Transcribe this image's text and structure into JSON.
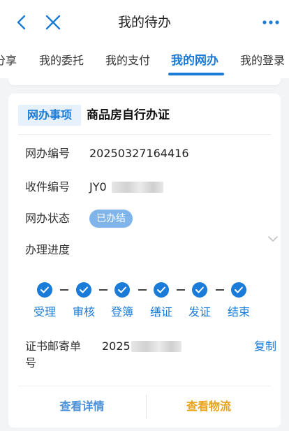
{
  "header": {
    "title": "我的待办",
    "back_icon": "chevron-left-icon",
    "close_icon": "close-icon",
    "more_icon": "more-horizontal-icon"
  },
  "tabs": [
    {
      "label": "分享",
      "active": false
    },
    {
      "label": "我的委托",
      "active": false
    },
    {
      "label": "我的支付",
      "active": false
    },
    {
      "label": "我的网办",
      "active": true
    },
    {
      "label": "我的登录",
      "active": false
    }
  ],
  "card": {
    "type_tag": "网办事项",
    "case_name": "商品房自行办证",
    "fields": {
      "number_label": "网办编号",
      "number_value": "20250327164416",
      "receipt_label": "收件编号",
      "receipt_value_visible": "JY0",
      "status_label": "网办状态",
      "status_value": "已办结",
      "progress_label": "办理进度"
    },
    "steps": [
      {
        "label": "受理",
        "done": true
      },
      {
        "label": "审核",
        "done": true
      },
      {
        "label": "登簿",
        "done": true
      },
      {
        "label": "缮证",
        "done": true
      },
      {
        "label": "发证",
        "done": true
      },
      {
        "label": "结束",
        "done": true
      }
    ],
    "mail": {
      "label": "证书邮寄单号",
      "value_visible": "2025",
      "copy_label": "复制"
    },
    "actions": {
      "detail_label": "查看详情",
      "logistics_label": "查看物流"
    }
  },
  "colors": {
    "accent": "#1a7bd8",
    "status_badge": "#7fb5ea",
    "logistics": "#e8a317"
  }
}
